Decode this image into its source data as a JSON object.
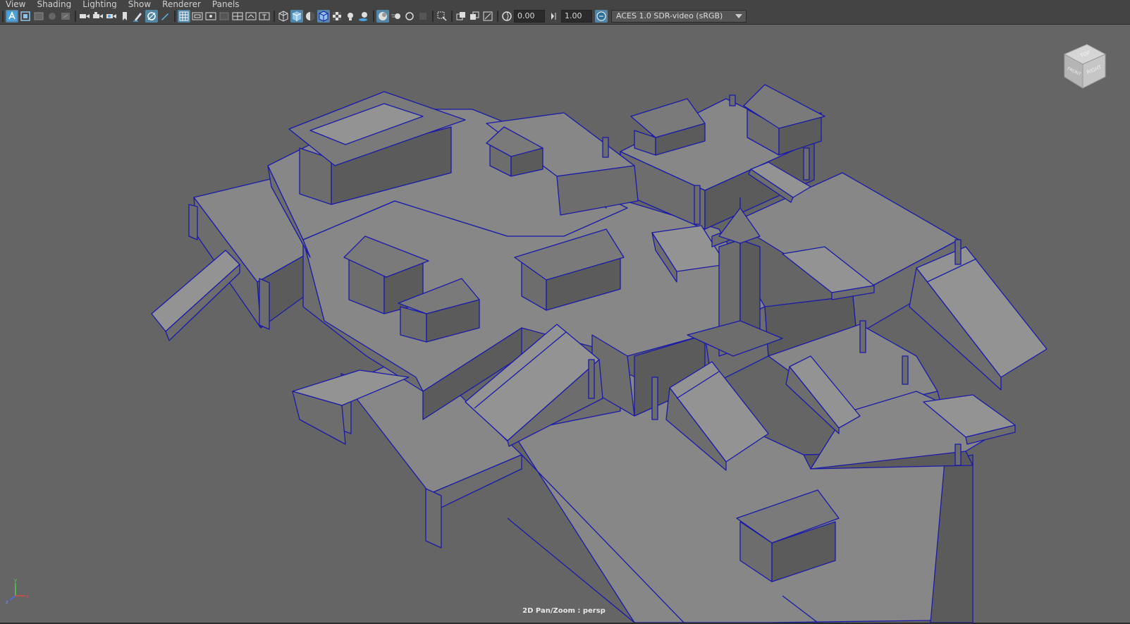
{
  "menu": [
    {
      "id": "view",
      "label": "View"
    },
    {
      "id": "shading",
      "label": "Shading"
    },
    {
      "id": "lighting",
      "label": "Lighting"
    },
    {
      "id": "show",
      "label": "Show"
    },
    {
      "id": "renderer",
      "label": "Renderer"
    },
    {
      "id": "panels",
      "label": "Panels"
    }
  ],
  "toolbar": {
    "exposure_value": "0.00",
    "gamma_value": "1.00",
    "color_management": "ACES 1.0 SDR-video (sRGB)"
  },
  "viewcube": {
    "top": "TOP",
    "right": "RIGHT",
    "front": "FRONT"
  },
  "axis": {
    "y": "y",
    "x": "x",
    "z": "z"
  },
  "colors": {
    "wireframe": "#1a1aa8",
    "viewport_bg": "#656565",
    "toolbar_bg": "#444444",
    "active_button": "#5285a6"
  },
  "viewport": {
    "camera_label": "2D Pan/Zoom : persp"
  }
}
